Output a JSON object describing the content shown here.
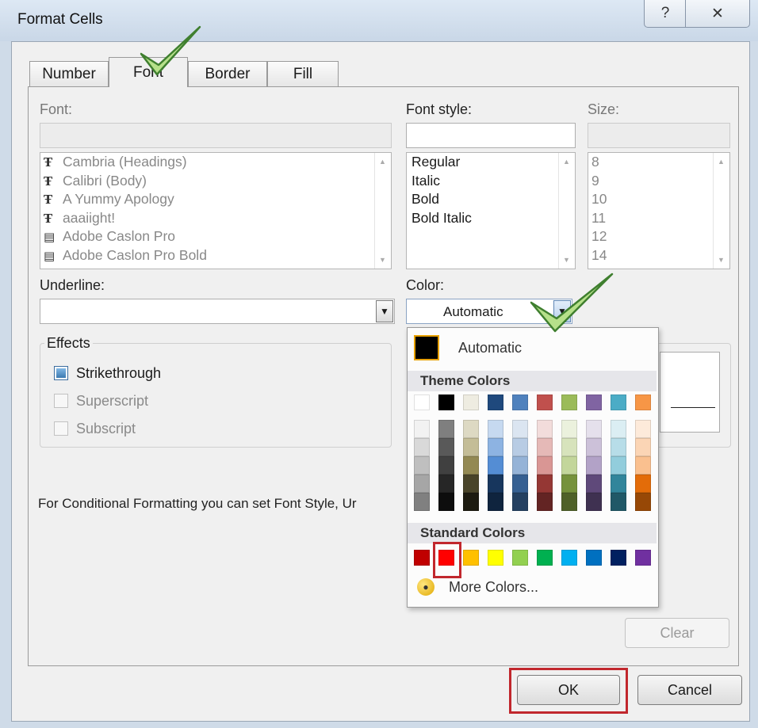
{
  "window": {
    "title": "Format Cells",
    "help_glyph": "?",
    "close_glyph": "✕"
  },
  "tabs": [
    {
      "label": "Number"
    },
    {
      "label": "Font"
    },
    {
      "label": "Border"
    },
    {
      "label": "Fill"
    }
  ],
  "font": {
    "label": "Font:",
    "input_value": "",
    "items": [
      {
        "icon": "truetype-icon",
        "label": "Cambria (Headings)"
      },
      {
        "icon": "truetype-icon",
        "label": "Calibri (Body)"
      },
      {
        "icon": "truetype-icon",
        "label": "A Yummy Apology"
      },
      {
        "icon": "truetype-icon",
        "label": "aaaiight!"
      },
      {
        "icon": "printer-font-icon",
        "label": "Adobe Caslon Pro"
      },
      {
        "icon": "printer-font-icon",
        "label": "Adobe Caslon Pro Bold"
      }
    ]
  },
  "font_style": {
    "label": "Font style:",
    "input_value": "",
    "items": [
      "Regular",
      "Italic",
      "Bold",
      "Bold Italic"
    ]
  },
  "size": {
    "label": "Size:",
    "input_value": "",
    "items": [
      "8",
      "9",
      "10",
      "11",
      "12",
      "14"
    ]
  },
  "underline": {
    "label": "Underline:",
    "value": ""
  },
  "color": {
    "label": "Color:",
    "value": "Automatic"
  },
  "effects": {
    "label": "Effects",
    "items": [
      {
        "label": "Strikethrough",
        "checked": true,
        "enabled": true
      },
      {
        "label": "Superscript",
        "checked": false,
        "enabled": false
      },
      {
        "label": "Subscript",
        "checked": false,
        "enabled": false
      }
    ]
  },
  "note": "For Conditional Formatting you can set Font Style, Ur",
  "palette": {
    "automatic_label": "Automatic",
    "theme_header": "Theme Colors",
    "standard_header": "Standard Colors",
    "more_label": "More Colors...",
    "theme_top": [
      "#ffffff",
      "#000000",
      "#eeece1",
      "#1f497d",
      "#4f81bd",
      "#c0504d",
      "#9bbb59",
      "#8064a2",
      "#4bacc6",
      "#f79646"
    ],
    "theme_shades": [
      [
        "#f2f2f2",
        "#d9d9d9",
        "#bfbfbf",
        "#a6a6a6",
        "#808080"
      ],
      [
        "#7f7f7f",
        "#595959",
        "#404040",
        "#262626",
        "#0d0d0d"
      ],
      [
        "#ddd9c3",
        "#c4bd97",
        "#938953",
        "#494429",
        "#1d1b10"
      ],
      [
        "#c6d9f0",
        "#8db3e2",
        "#548dd4",
        "#17365d",
        "#0f243e"
      ],
      [
        "#dbe5f1",
        "#b8cce4",
        "#95b3d7",
        "#366092",
        "#244061"
      ],
      [
        "#f2dcdb",
        "#e5b9b7",
        "#d99694",
        "#953734",
        "#632423"
      ],
      [
        "#ebf1dd",
        "#d7e3bc",
        "#c3d69b",
        "#76923c",
        "#4f6128"
      ],
      [
        "#e5e0ec",
        "#ccc1d9",
        "#b2a2c7",
        "#5f497a",
        "#3f3151"
      ],
      [
        "#dbeef3",
        "#b7dde8",
        "#92cddc",
        "#31859b",
        "#205867"
      ],
      [
        "#fdeada",
        "#fbd5b5",
        "#fac08f",
        "#e36c09",
        "#974806"
      ]
    ],
    "standard": [
      "#c00000",
      "#ff0000",
      "#ffc000",
      "#ffff00",
      "#92d050",
      "#00b050",
      "#00b0f0",
      "#0070c0",
      "#002060",
      "#7030a0"
    ]
  },
  "buttons": {
    "clear": "Clear",
    "ok": "OK",
    "cancel": "Cancel"
  },
  "highlight_color": "#c1272d"
}
